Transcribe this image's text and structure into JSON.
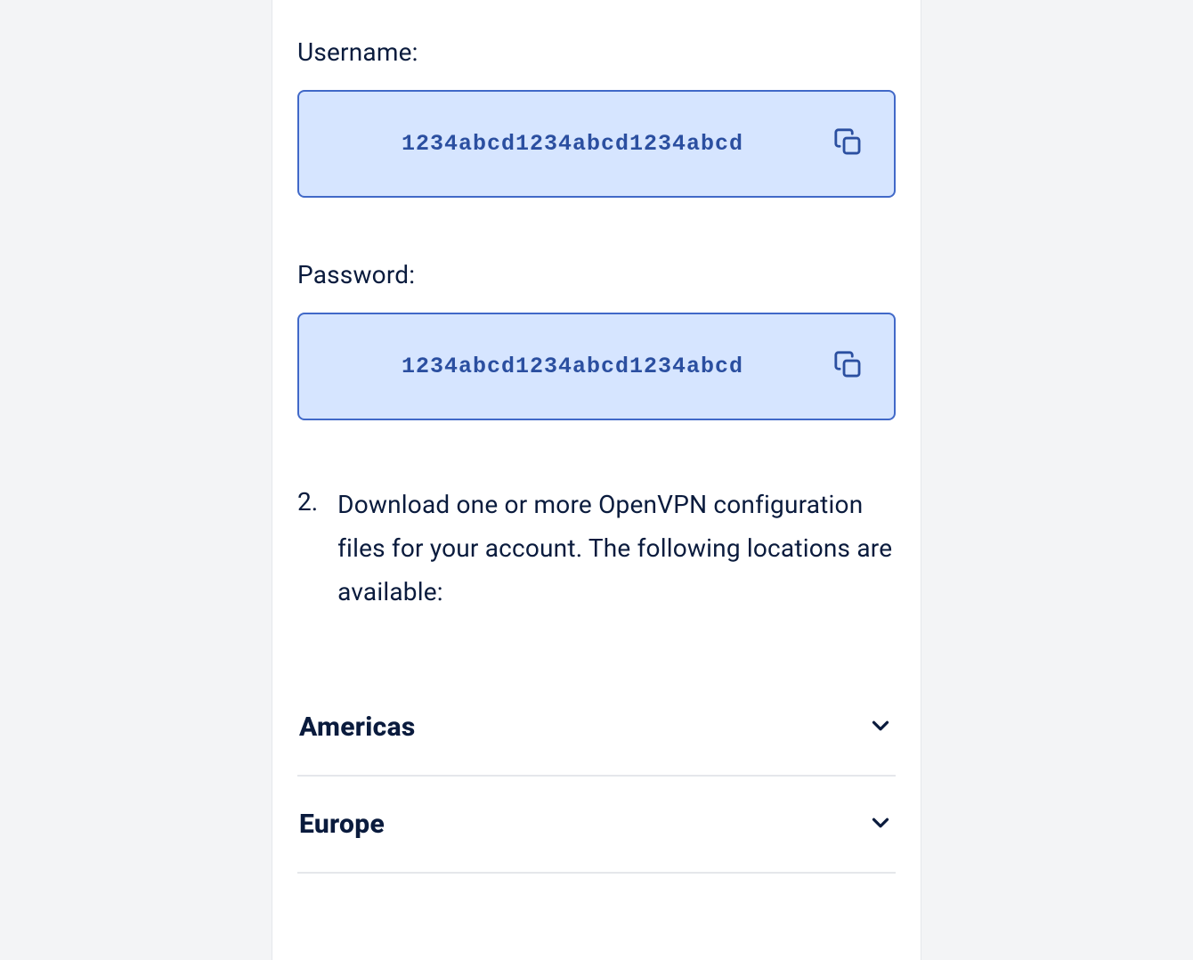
{
  "credentials": {
    "username_label": "Username:",
    "username_value": "1234abcd1234abcd1234abcd",
    "password_label": "Password:",
    "password_value": "1234abcd1234abcd1234abcd"
  },
  "steps": {
    "number2": "2.",
    "text2": "Download one or more OpenVPN configuration files for your account. The following locations are available:"
  },
  "regions": {
    "americas": "Americas",
    "europe": "Europe"
  }
}
